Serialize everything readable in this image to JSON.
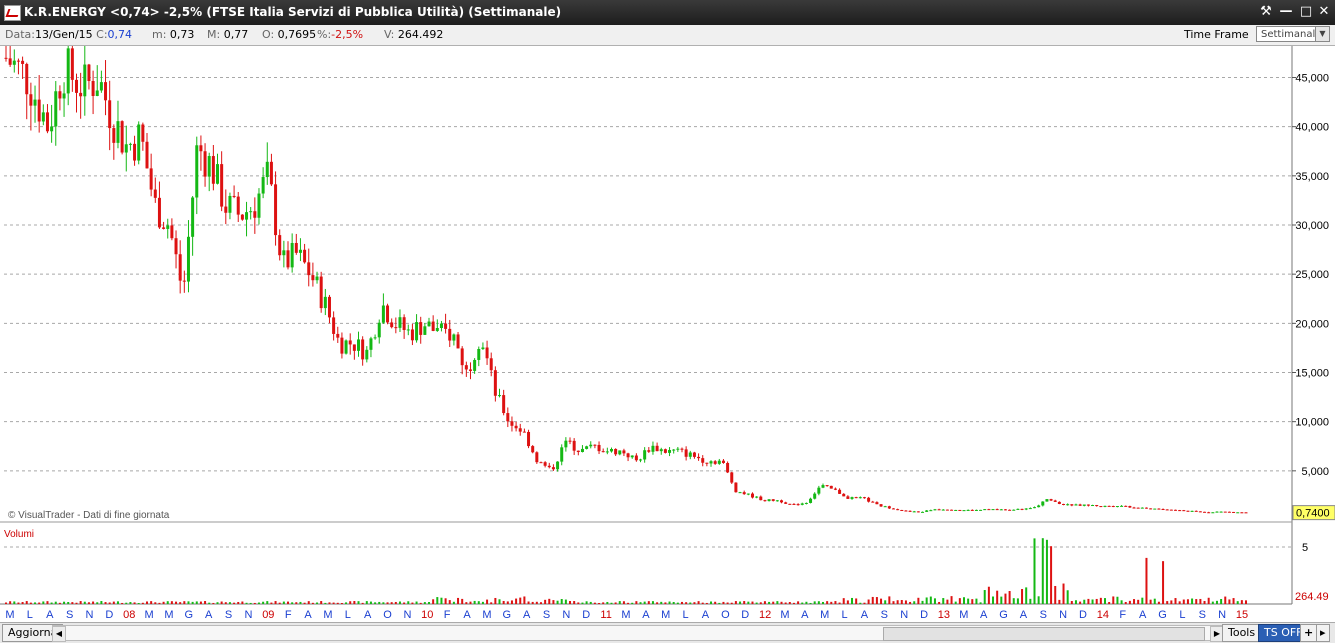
{
  "window": {
    "title": "K.R.ENERGY <0,74> -2,5%  (FTSE Italia Servizi di Pubblica Utilità)  (Settimanale)",
    "buttons": [
      "⚒",
      "—",
      "□",
      "✕"
    ]
  },
  "infobar": {
    "data_label": "Data:",
    "data_value": "13/Gen/15",
    "c_label": "C:",
    "c_value": "0,74",
    "m_label": "m:",
    "m_value": "0,73",
    "M_label": "M:",
    "M_value": "0,77",
    "o_label": "O:",
    "o_value": "0,7695",
    "pct_label": "%:",
    "pct_value": "-2,5%",
    "v_label": "V:",
    "v_value": "264.492",
    "timeframe_label": "Time Frame",
    "timeframe_value": "Settimanale"
  },
  "chart_data": {
    "type": "candlestick",
    "price_axis_labels": [
      "45,000",
      "40,000",
      "35,000",
      "30,000",
      "25,000",
      "20,000",
      "15,000",
      "10,000",
      "5,000"
    ],
    "price_ticks": [
      45,
      40,
      35,
      30,
      25,
      20,
      15,
      10,
      5
    ],
    "ylim": [
      0,
      48
    ],
    "last_price_label": "0,7400",
    "watermark": "© VisualTrader - Dati di fine giornata",
    "volume_label": "Volumi",
    "volume_axis_label": "5",
    "volume_last_label": "264.49",
    "price_path": [
      [
        0,
        47
      ],
      [
        3,
        45
      ],
      [
        6,
        40
      ],
      [
        8,
        46
      ],
      [
        11,
        44
      ],
      [
        13,
        45
      ],
      [
        15,
        41
      ],
      [
        17,
        38
      ],
      [
        19,
        39
      ],
      [
        21,
        32
      ],
      [
        23,
        30
      ],
      [
        25,
        23
      ],
      [
        27,
        38
      ],
      [
        29,
        36
      ],
      [
        31,
        32
      ],
      [
        33,
        31
      ],
      [
        35,
        32
      ],
      [
        37,
        35
      ],
      [
        39,
        26
      ],
      [
        41,
        27
      ],
      [
        43,
        25
      ],
      [
        45,
        22
      ],
      [
        47,
        18
      ],
      [
        49,
        18
      ],
      [
        51,
        17
      ],
      [
        53,
        22
      ],
      [
        55,
        20
      ],
      [
        57,
        19
      ],
      [
        59,
        20
      ],
      [
        61,
        19
      ],
      [
        63,
        19
      ],
      [
        65,
        15
      ],
      [
        67,
        19
      ],
      [
        69,
        13
      ],
      [
        71,
        10
      ],
      [
        73,
        9
      ],
      [
        75,
        6
      ],
      [
        77,
        5
      ],
      [
        79,
        8
      ],
      [
        81,
        7
      ],
      [
        83,
        7.5
      ],
      [
        85,
        7
      ],
      [
        87,
        7
      ],
      [
        89,
        6
      ],
      [
        91,
        7.5
      ],
      [
        93,
        7
      ],
      [
        95,
        7
      ],
      [
        97,
        6.5
      ],
      [
        99,
        6
      ],
      [
        101,
        6
      ],
      [
        103,
        3
      ],
      [
        105,
        2.5
      ],
      [
        107,
        2
      ],
      [
        109,
        2
      ],
      [
        111,
        1.5
      ],
      [
        113,
        1.8
      ],
      [
        115,
        3.5
      ],
      [
        117,
        3
      ],
      [
        119,
        2.2
      ],
      [
        121,
        2.2
      ],
      [
        123,
        1.5
      ],
      [
        125,
        1.2
      ],
      [
        127,
        0.9
      ],
      [
        129,
        0.8
      ],
      [
        131,
        1.1
      ],
      [
        133,
        1.1
      ],
      [
        135,
        1.0
      ],
      [
        137,
        1.0
      ],
      [
        139,
        1.1
      ],
      [
        141,
        1.0
      ],
      [
        143,
        1.1
      ],
      [
        145,
        1.2
      ],
      [
        147,
        2.2
      ],
      [
        149,
        1.6
      ],
      [
        151,
        1.5
      ],
      [
        153,
        1.5
      ],
      [
        155,
        1.4
      ],
      [
        157,
        1.5
      ],
      [
        159,
        1.3
      ],
      [
        161,
        1.2
      ],
      [
        163,
        1.1
      ],
      [
        165,
        1.0
      ],
      [
        167,
        0.9
      ],
      [
        169,
        0.8
      ],
      [
        171,
        0.85
      ],
      [
        173,
        0.8
      ],
      [
        175,
        0.75
      ]
    ],
    "x_axis_labels": [
      {
        "t": "M",
        "c": "blue"
      },
      {
        "t": "L",
        "c": "blue"
      },
      {
        "t": "A",
        "c": "blue"
      },
      {
        "t": "S",
        "c": "blue"
      },
      {
        "t": "N",
        "c": "blue"
      },
      {
        "t": "D",
        "c": "blue"
      },
      {
        "t": "08",
        "c": "red"
      },
      {
        "t": "M",
        "c": "blue"
      },
      {
        "t": "M",
        "c": "blue"
      },
      {
        "t": "G",
        "c": "blue"
      },
      {
        "t": "A",
        "c": "blue"
      },
      {
        "t": "S",
        "c": "blue"
      },
      {
        "t": "N",
        "c": "blue"
      },
      {
        "t": "09",
        "c": "red"
      },
      {
        "t": "F",
        "c": "blue"
      },
      {
        "t": "A",
        "c": "blue"
      },
      {
        "t": "M",
        "c": "blue"
      },
      {
        "t": "L",
        "c": "blue"
      },
      {
        "t": "A",
        "c": "blue"
      },
      {
        "t": "O",
        "c": "blue"
      },
      {
        "t": "N",
        "c": "blue"
      },
      {
        "t": "10",
        "c": "red"
      },
      {
        "t": "F",
        "c": "blue"
      },
      {
        "t": "A",
        "c": "blue"
      },
      {
        "t": "M",
        "c": "blue"
      },
      {
        "t": "G",
        "c": "blue"
      },
      {
        "t": "A",
        "c": "blue"
      },
      {
        "t": "S",
        "c": "blue"
      },
      {
        "t": "N",
        "c": "blue"
      },
      {
        "t": "D",
        "c": "blue"
      },
      {
        "t": "11",
        "c": "red"
      },
      {
        "t": "M",
        "c": "blue"
      },
      {
        "t": "A",
        "c": "blue"
      },
      {
        "t": "M",
        "c": "blue"
      },
      {
        "t": "L",
        "c": "blue"
      },
      {
        "t": "A",
        "c": "blue"
      },
      {
        "t": "O",
        "c": "blue"
      },
      {
        "t": "D",
        "c": "blue"
      },
      {
        "t": "12",
        "c": "red"
      },
      {
        "t": "M",
        "c": "blue"
      },
      {
        "t": "A",
        "c": "blue"
      },
      {
        "t": "M",
        "c": "blue"
      },
      {
        "t": "L",
        "c": "blue"
      },
      {
        "t": "A",
        "c": "blue"
      },
      {
        "t": "S",
        "c": "blue"
      },
      {
        "t": "N",
        "c": "blue"
      },
      {
        "t": "D",
        "c": "blue"
      },
      {
        "t": "13",
        "c": "red"
      },
      {
        "t": "M",
        "c": "blue"
      },
      {
        "t": "A",
        "c": "blue"
      },
      {
        "t": "G",
        "c": "blue"
      },
      {
        "t": "A",
        "c": "blue"
      },
      {
        "t": "S",
        "c": "blue"
      },
      {
        "t": "N",
        "c": "blue"
      },
      {
        "t": "D",
        "c": "blue"
      },
      {
        "t": "14",
        "c": "red"
      },
      {
        "t": "F",
        "c": "blue"
      },
      {
        "t": "A",
        "c": "blue"
      },
      {
        "t": "G",
        "c": "blue"
      },
      {
        "t": "L",
        "c": "blue"
      },
      {
        "t": "S",
        "c": "blue"
      },
      {
        "t": "N",
        "c": "blue"
      },
      {
        "t": "15",
        "c": "red"
      }
    ],
    "colors": {
      "up": "#14b814",
      "down": "#dd1111",
      "grid": "#a8a8a8",
      "axis_blue": "#1a3fd0",
      "axis_red": "#cc0000",
      "last_price_bg": "#ffff66"
    }
  },
  "bottombar": {
    "refresh_label": "Aggiorna",
    "tools_label": "Tools",
    "ts_label": "TS OFF",
    "plus_label": "+",
    "more_label": "▸"
  }
}
